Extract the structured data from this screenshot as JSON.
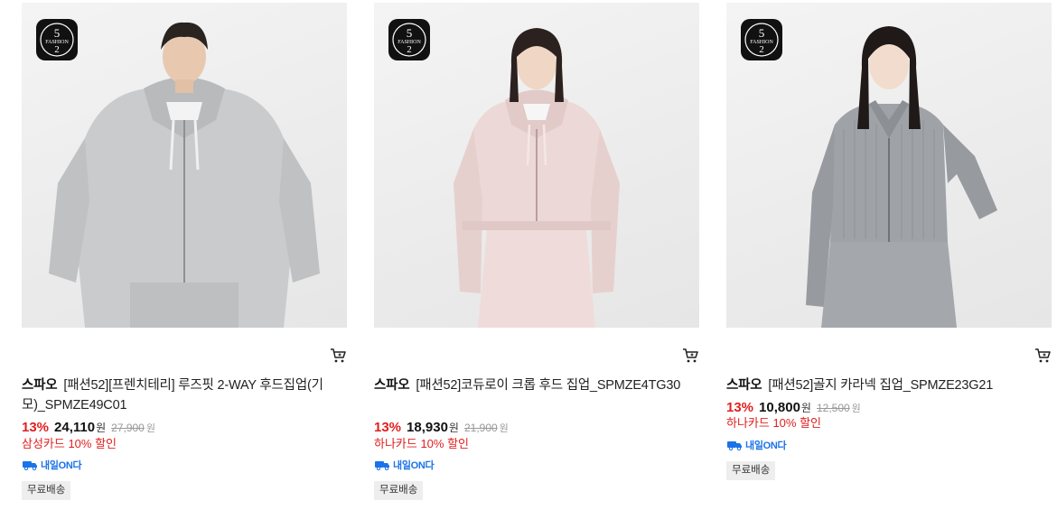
{
  "products": [
    {
      "badge_text": "FASHION 52",
      "image_alt": "Man wearing light gray zip-up hoodie",
      "brand": "스파오",
      "name": "[패션52][프렌치테리] 루즈핏 2-WAY 후드집업(기모)_SPMZE49C01",
      "discount_rate": "13%",
      "price": "24,110",
      "price_unit": "원",
      "original_price": "27,900",
      "original_unit": "원",
      "card_discount": "삼성카드 10% 할인",
      "delivery_label": "내일ON다",
      "shipping_tag": "무료배송",
      "cart_icon": "cart-icon"
    },
    {
      "badge_text": "FASHION 52",
      "image_alt": "Woman wearing pink corduroy crop zip-up hoodie",
      "brand": "스파오",
      "name": "[패션52]코듀로이 크롭 후드 집업_SPMZE4TG30",
      "discount_rate": "13%",
      "price": "18,930",
      "price_unit": "원",
      "original_price": "21,900",
      "original_unit": "원",
      "card_discount": "하나카드 10% 할인",
      "delivery_label": "내일ON다",
      "shipping_tag": "무료배송",
      "cart_icon": "cart-icon"
    },
    {
      "badge_text": "FASHION 52",
      "image_alt": "Woman wearing gray ribbed collar zip-up",
      "brand": "스파오",
      "name": "[패션52]골지 카라넥 집업_SPMZE23G21",
      "discount_rate": "13%",
      "price": "10,800",
      "price_unit": "원",
      "original_price": "12,500",
      "original_unit": "원",
      "card_discount": "하나카드 10% 할인",
      "delivery_label": "내일ON다",
      "shipping_tag": "무료배송",
      "cart_icon": "cart-icon"
    }
  ],
  "colors": {
    "discount_red": "#e02020",
    "delivery_blue": "#1a73e8",
    "tag_bg": "#eeeeee"
  }
}
